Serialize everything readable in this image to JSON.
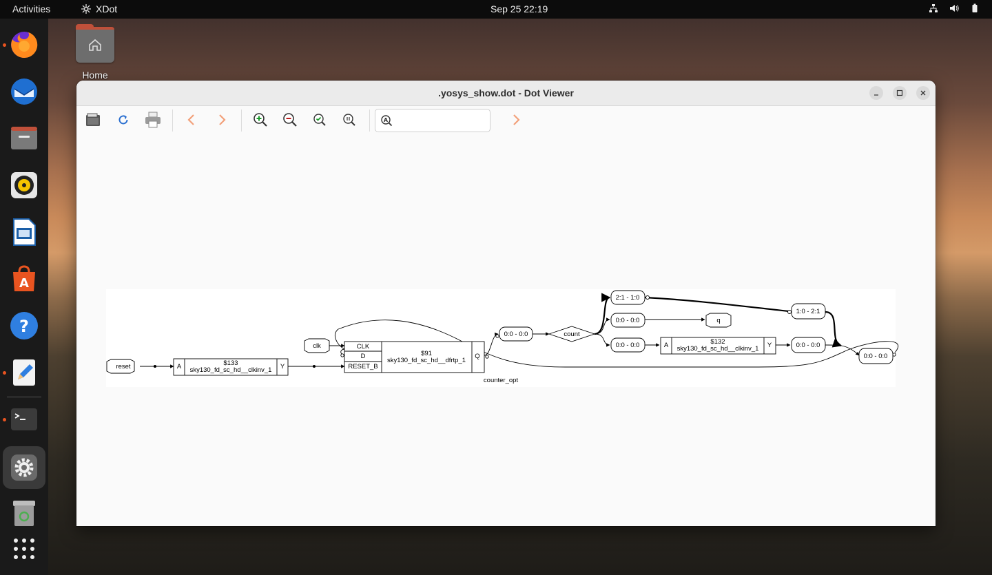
{
  "topbar": {
    "activities": "Activities",
    "app_name": "XDot",
    "clock": "Sep 25  22:19"
  },
  "desktop": {
    "home_label": "Home"
  },
  "dock": {
    "items": [
      "firefox-icon",
      "thunderbird-icon",
      "files-icon",
      "rhythmbox-icon",
      "libreoffice-impress-icon",
      "app-center-icon",
      "help-icon",
      "text-editor-icon",
      "terminal-icon",
      "settings-icon",
      "trash-icon",
      "show-apps-icon"
    ]
  },
  "window": {
    "title": ".yosys_show.dot - Dot Viewer",
    "search_placeholder": ""
  },
  "graph": {
    "module_label": "counter_opt",
    "ports": {
      "reset": "reset",
      "clk": "clk",
      "q": "q"
    },
    "count_node": "count",
    "cell_133": {
      "id": "$133",
      "type": "sky130_fd_sc_hd__clkinv_1",
      "in": "A",
      "out": "Y"
    },
    "cell_91": {
      "id": "$91",
      "type": "sky130_fd_sc_hd__dfrtp_1",
      "pins": [
        "CLK",
        "D",
        "RESET_B"
      ],
      "out": "Q"
    },
    "cell_132": {
      "id": "$132",
      "type": "sky130_fd_sc_hd__clkinv_1",
      "in": "A",
      "out": "Y"
    },
    "slices": {
      "s1": "0:0 - 0:0",
      "s2": "2:1 - 1:0",
      "s3": "0:0 - 0:0",
      "s4": "0:0 - 0:0",
      "s5": "1:0 - 2:1",
      "s6": "0:0 - 0:0",
      "s7": "0:0 - 0:0"
    }
  }
}
